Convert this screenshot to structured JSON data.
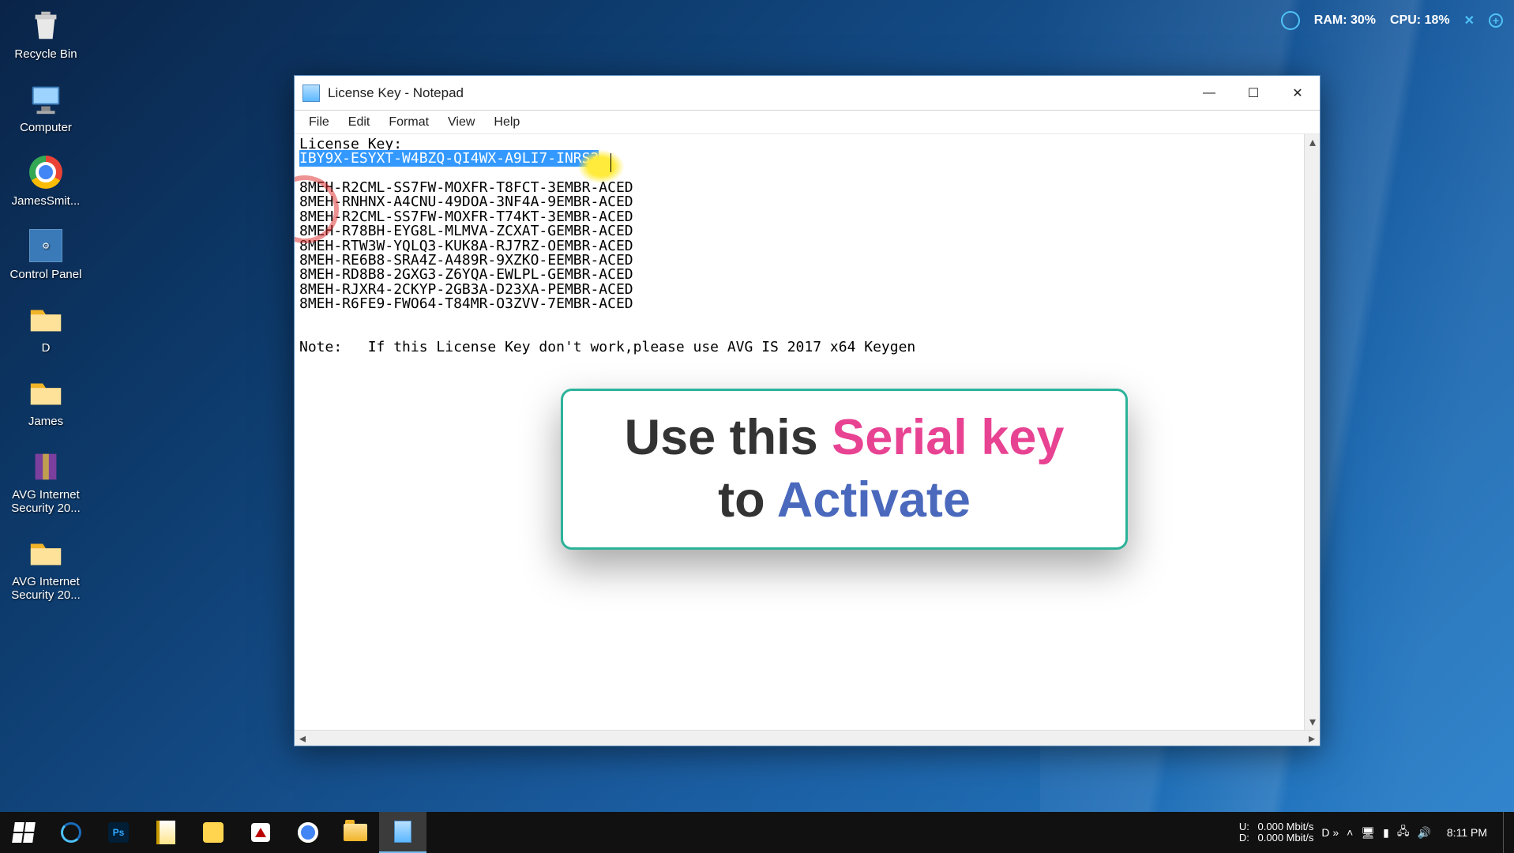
{
  "desktop": {
    "icons": [
      {
        "label": "Recycle Bin",
        "kind": "recycle"
      },
      {
        "label": "Computer",
        "kind": "computer"
      },
      {
        "label": "JamesSmit...",
        "kind": "chrome"
      },
      {
        "label": "Control Panel",
        "kind": "cpanel"
      },
      {
        "label": "D",
        "kind": "folder"
      },
      {
        "label": "James",
        "kind": "folder"
      },
      {
        "label": "AVG Internet Security 20...",
        "kind": "archive"
      },
      {
        "label": "AVG Internet Security 20...",
        "kind": "folder"
      }
    ]
  },
  "top_stats": {
    "ram": "RAM: 30%",
    "cpu": "CPU: 18%"
  },
  "notepad": {
    "title": "License Key - Notepad",
    "menu": {
      "file": "File",
      "edit": "Edit",
      "format": "Format",
      "view": "View",
      "help": "Help"
    },
    "lines": {
      "header": "License Key:",
      "selected": "IBY9X-ESYXT-W4BZQ-QI4WX-A9LI7-INRS3",
      "keys": [
        "8MEH-R2CML-SS7FW-MOXFR-T8FCT-3EMBR-ACED",
        "8MEH-RNHNX-A4CNU-49DOA-3NF4A-9EMBR-ACED",
        "8MEH-R2CML-SS7FW-MOXFR-T74KT-3EMBR-ACED",
        "8MEH-R78BH-EYG8L-MLMVA-ZCXAT-GEMBR-ACED",
        "8MEH-RTW3W-YQLQ3-KUK8A-RJ7RZ-OEMBR-ACED",
        "8MEH-RE6B8-SRA4Z-A489R-9XZKO-EEMBR-ACED",
        "8MEH-RD8B8-2GXG3-Z6YQA-EWLPL-GEMBR-ACED",
        "8MEH-RJXR4-2CKYP-2GB3A-D23XA-PEMBR-ACED",
        "8MEH-R6FE9-FWO64-T84MR-O3ZVV-7EMBR-ACED"
      ],
      "note": "Note:   If this License Key don't work,please use AVG IS 2017 x64 Keygen"
    }
  },
  "callout": {
    "t1": "Use this ",
    "t2": "Serial key",
    "t3": "to ",
    "t4": "Activate"
  },
  "taskbar": {
    "net": {
      "up_label": "U:",
      "up": "0.000 Mbit/s",
      "dn_label": "D:",
      "dn": "0.000 Mbit/s",
      "extra": "D »"
    },
    "clock": "8:11 PM"
  }
}
